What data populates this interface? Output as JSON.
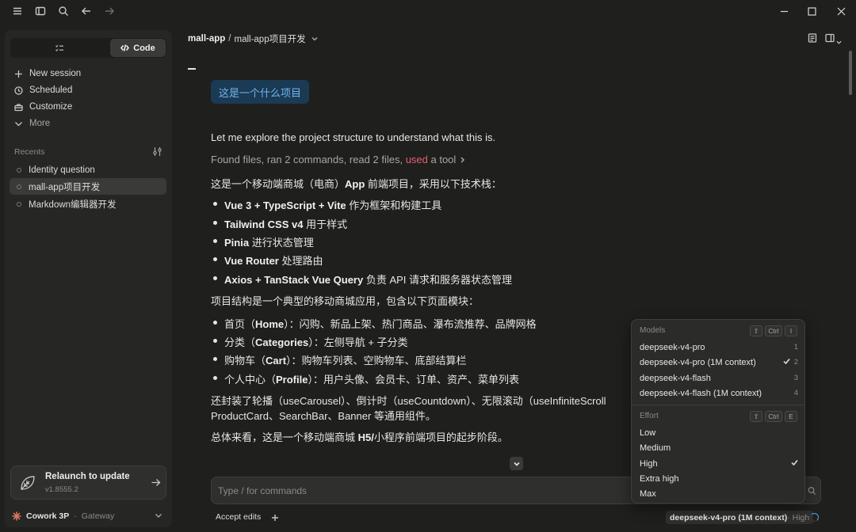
{
  "app": {
    "icons": [
      "menu-icon",
      "sidebar-toggle-icon",
      "search-icon",
      "back-arrow-icon",
      "forward-arrow-icon"
    ],
    "window_controls": [
      "minimize-icon",
      "maximize-icon",
      "close-icon"
    ]
  },
  "sidebar": {
    "mode_code_label": "Code",
    "nav": [
      {
        "label": "New session",
        "icon": "plus-icon"
      },
      {
        "label": "Scheduled",
        "icon": "clock-icon"
      },
      {
        "label": "Customize",
        "icon": "briefcase-icon"
      },
      {
        "label": "More",
        "icon": "chevron-down-icon"
      }
    ],
    "recents_label": "Recents",
    "recents": [
      {
        "label": "Identity question",
        "active": false
      },
      {
        "label": "mall-app项目开发",
        "active": true
      },
      {
        "label": "Markdown编辑器开发",
        "active": false
      }
    ],
    "update": {
      "title": "Relaunch to update",
      "version": "v1.8555.2"
    },
    "account": {
      "name": "Cowork 3P",
      "separator": "·",
      "gateway": "Gateway"
    }
  },
  "header": {
    "project": "mall-app",
    "slash": "/",
    "session": "mall-app项目开发"
  },
  "conversation": {
    "user_message": "这是一个什么项目",
    "assistant_intro": "Let me explore the project structure to understand what this is.",
    "tools_summary": {
      "prefix": "Found files, ran 2 commands, read 2 files, ",
      "used": "used",
      "suffix": " a tool"
    },
    "stack_intro": {
      "a": "这是一个移动端商城（电商）",
      "b": "App",
      "c": " 前端项目，采用以下技术栈："
    },
    "stack": [
      {
        "bold": "Vue 3 + TypeScript + Vite",
        "rest": " 作为框架和构建工具"
      },
      {
        "bold": "Tailwind CSS v4",
        "rest": " 用于样式"
      },
      {
        "bold": "Pinia",
        "rest": " 进行状态管理"
      },
      {
        "bold": "Vue Router",
        "rest": " 处理路由"
      },
      {
        "bold": "Axios + TanStack Vue Query",
        "rest": " 负责 API 请求和服务器状态管理"
      }
    ],
    "structure_intro": "项目结构是一个典型的移动商城应用，包含以下页面模块：",
    "modules": [
      {
        "a": "首页（",
        "bold": "Home",
        "b": "）：闪购、新品上架、热门商品、瀑布流推荐、品牌网格"
      },
      {
        "a": "分类（",
        "bold": "Categories",
        "b": "）：左侧导航 + 子分类"
      },
      {
        "a": "购物车（",
        "bold": "Cart",
        "b": "）：购物车列表、空购物车、底部结算栏"
      },
      {
        "a": "个人中心（",
        "bold": "Profile",
        "b": "）：用户头像、会员卡、订单、资产、菜单列表"
      }
    ],
    "composables_line1": "还封装了轮播（useCarousel）、倒计时（useCountdown）、无限滚动（useInfiniteScroll",
    "composables_line2": "ProductCard、SearchBar、Banner 等通用组件。",
    "summary": {
      "a": "总体来看，这是一个移动端商城 ",
      "bold": "H5/",
      "b": "小程序前端项目的起步阶段。"
    }
  },
  "composer": {
    "placeholder": "Type / for commands",
    "accept_edits": "Accept edits",
    "model_pill": "deepseek-v4-pro (1M context)",
    "effort_pill": " · High"
  },
  "model_menu": {
    "models_heading": "Models",
    "models_shortcut": [
      "⇧",
      "Ctrl",
      "I"
    ],
    "models": [
      {
        "label": "deepseek-v4-pro",
        "num": "1",
        "selected": false
      },
      {
        "label": "deepseek-v4-pro (1M context)",
        "num": "2",
        "selected": true
      },
      {
        "label": "deepseek-v4-flash",
        "num": "3",
        "selected": false
      },
      {
        "label": "deepseek-v4-flash (1M context)",
        "num": "4",
        "selected": false
      }
    ],
    "effort_heading": "Effort",
    "effort_shortcut": [
      "⇧",
      "Ctrl",
      "E"
    ],
    "efforts": [
      {
        "label": "Low",
        "selected": false
      },
      {
        "label": "Medium",
        "selected": false
      },
      {
        "label": "High",
        "selected": true
      },
      {
        "label": "Extra high",
        "selected": false
      },
      {
        "label": "Max",
        "selected": false
      }
    ]
  },
  "colors": {
    "background": "#1f1f1e",
    "sidebar": "#262625",
    "user_bubble": "#1b3a54",
    "user_text": "#6fb6ef",
    "accent_used": "#e5606f",
    "brand": "#d97757"
  }
}
